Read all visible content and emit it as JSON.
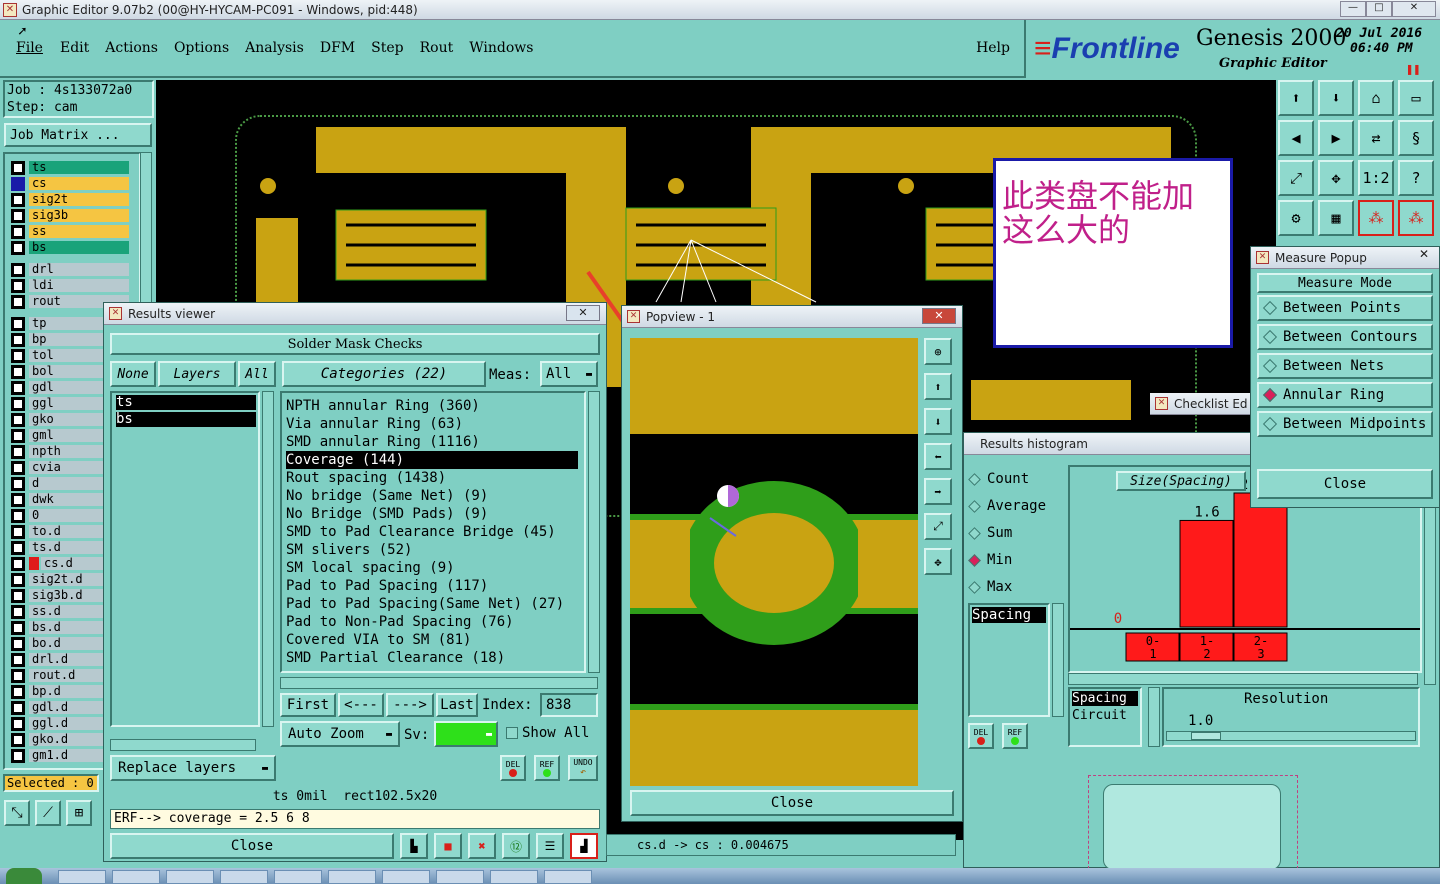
{
  "window": {
    "title": "Graphic Editor 9.07b2 (00@HY-HYCAM-PC091 - Windows, pid:448)",
    "controls": [
      "—",
      "□",
      "✕"
    ]
  },
  "menu": [
    "File",
    "Edit",
    "Actions",
    "Options",
    "Analysis",
    "DFM",
    "Step",
    "Rout",
    "Windows"
  ],
  "help": "Help",
  "brand": {
    "logo": "Frontline",
    "product": "Genesis 2000",
    "subtitle": "Graphic Editor",
    "date": "20 Jul 2016",
    "time": "06:40 PM"
  },
  "job": {
    "job_label": "Job : 4s133072a0",
    "step_label": "Step: cam",
    "matrix_button": "Job Matrix ..."
  },
  "layers": [
    {
      "name": "ts",
      "color": "#1aa37a"
    },
    {
      "name": "cs",
      "color": "#f5c542"
    },
    {
      "name": "sig2t",
      "color": "#f5c542"
    },
    {
      "name": "sig3b",
      "color": "#f5c542"
    },
    {
      "name": "ss",
      "color": "#f5c542"
    },
    {
      "name": "bs",
      "color": "#1aa37a"
    },
    {
      "name": "drl",
      "color": "#b7c9cf"
    },
    {
      "name": "ldi",
      "color": "#b7c9cf"
    },
    {
      "name": "rout",
      "color": "#b7c9cf"
    },
    {
      "name": "tp",
      "color": "#b7c9cf"
    },
    {
      "name": "bp",
      "color": "#b7c9cf"
    },
    {
      "name": "tol",
      "color": "#b7c9cf"
    },
    {
      "name": "bol",
      "color": "#b7c9cf"
    },
    {
      "name": "gdl",
      "color": "#b7c9cf"
    },
    {
      "name": "ggl",
      "color": "#b7c9cf"
    },
    {
      "name": "gko",
      "color": "#b7c9cf"
    },
    {
      "name": "gml",
      "color": "#b7c9cf"
    },
    {
      "name": "npth",
      "color": "#b7c9cf"
    },
    {
      "name": "cvia",
      "color": "#b7c9cf"
    },
    {
      "name": "d",
      "color": "#b7c9cf"
    },
    {
      "name": "dwk",
      "color": "#b7c9cf"
    },
    {
      "name": "0",
      "color": "#b7c9cf"
    },
    {
      "name": "to.d",
      "color": "#b7c9cf"
    },
    {
      "name": "ts.d",
      "color": "#b7c9cf"
    },
    {
      "name": "cs.d",
      "color": "#b7c9cf"
    },
    {
      "name": "sig2t.d",
      "color": "#b7c9cf"
    },
    {
      "name": "sig3b.d",
      "color": "#b7c9cf"
    },
    {
      "name": "ss.d",
      "color": "#b7c9cf"
    },
    {
      "name": "bs.d",
      "color": "#b7c9cf"
    },
    {
      "name": "bo.d",
      "color": "#b7c9cf"
    },
    {
      "name": "drl.d",
      "color": "#b7c9cf"
    },
    {
      "name": "rout.d",
      "color": "#b7c9cf"
    },
    {
      "name": "bp.d",
      "color": "#b7c9cf"
    },
    {
      "name": "gdl.d",
      "color": "#b7c9cf"
    },
    {
      "name": "ggl.d",
      "color": "#b7c9cf"
    },
    {
      "name": "gko.d",
      "color": "#b7c9cf"
    },
    {
      "name": "gm1.d",
      "color": "#b7c9cf"
    }
  ],
  "selected": "Selected : 0",
  "annotation": {
    "line1": "此类盘不能加",
    "line2": "这么大的"
  },
  "results_viewer": {
    "title": "Results viewer",
    "header": "Solder Mask Checks",
    "none": "None",
    "layers": "Layers",
    "all": "All",
    "categories_label": "Categories (22)",
    "meas_label": "Meas:",
    "meas_value": "All",
    "layer_list": [
      "ts",
      "bs"
    ],
    "categories": [
      "NPTH annular Ring (360)",
      "Via annular Ring (63)",
      "SMD annular Ring (1116)",
      "Coverage (144)",
      "Rout spacing (1438)",
      "No bridge (Same Net) (9)",
      "No Bridge (SMD Pads) (9)",
      "SMD to Pad Clearance Bridge (45)",
      "SM slivers (52)",
      "SM local spacing (9)",
      "Pad to Pad Spacing (117)",
      "Pad to Pad Spacing(Same Net) (27)",
      "Pad to Non-Pad Spacing (76)",
      "Covered VIA to SM (81)",
      "SMD Partial Clearance (18)"
    ],
    "selected_category": "Coverage (144)",
    "first": "First",
    "prev": "<---",
    "next": "--->",
    "last": "Last",
    "index_label": "Index:",
    "index_value": "838",
    "auto_zoom": "Auto Zoom",
    "sv_label": "Sv:",
    "show_all": "Show All",
    "replace_layers": "Replace layers",
    "info_line": "ts 0mil  rect102.5x20",
    "erf_line": "ERF--> coverage = 2.5 6 8",
    "close": "Close",
    "del": "DEL",
    "ref": "REF",
    "undo": "UNDO"
  },
  "popview": {
    "title": "Popview - 1",
    "close": "Close"
  },
  "status_line": "cs.d -> cs : 0.004675",
  "measure_popup": {
    "title": "Measure Popup",
    "header": "Measure Mode",
    "items": [
      "Between Points",
      "Between Contours",
      "Between Nets",
      "Annular Ring",
      "Between Midpoints"
    ],
    "selected": "Annular Ring",
    "close": "Close"
  },
  "checklist": {
    "title": "Checklist Ed"
  },
  "histogram": {
    "title": "Results histogram",
    "options": [
      "Count",
      "Average",
      "Sum",
      "Min",
      "Max"
    ],
    "selected": "Min",
    "list_item": "Spacing",
    "size_label": "Size(Spacing)",
    "spacing_box": [
      "Spacing",
      "Circuit"
    ],
    "resolution_label": "Resolution",
    "resolution_value": "1.0",
    "del": "DEL",
    "ref": "REF"
  },
  "chart_data": {
    "type": "bar",
    "categories": [
      "0-1",
      "1-2",
      "2-3"
    ],
    "category_labels": [
      [
        "0-",
        "1"
      ],
      [
        "1-",
        "2"
      ],
      [
        "2-",
        "3"
      ]
    ],
    "values": [
      0,
      1.6,
      2.012
    ],
    "value_labels": [
      "0",
      "1.6",
      "2.012"
    ],
    "xlabel": "Size(Spacing)",
    "bar_color": "#ff1a1a"
  },
  "colors": {
    "ui_teal": "#7fcfc3",
    "copper": "#c9a312",
    "soldermask": "#2f9e1a",
    "canvas": "#000000",
    "arrow": "#e8402a"
  }
}
